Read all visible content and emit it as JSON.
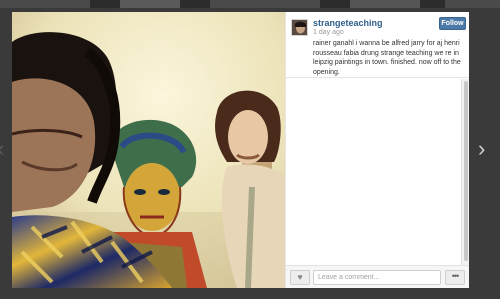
{
  "post": {
    "username": "strangeteaching",
    "timestamp": "1 day ago",
    "follow_label": "Follow",
    "caption": "rainer ganahl i wanna be alfred jarry for aj henri rousseau fabia drung strange teaching we re in leipzig paintings in town. finished. now off to the opening."
  },
  "comment": {
    "placeholder": "Leave a comment..."
  },
  "icons": {
    "like": "heart-icon",
    "more": "more-icon",
    "prev": "chevron-left-icon",
    "next": "chevron-right-icon"
  },
  "colors": {
    "username": "#2f5f8a",
    "follow_button": "#4c7aa8",
    "backdrop": "#3a3a3a"
  }
}
